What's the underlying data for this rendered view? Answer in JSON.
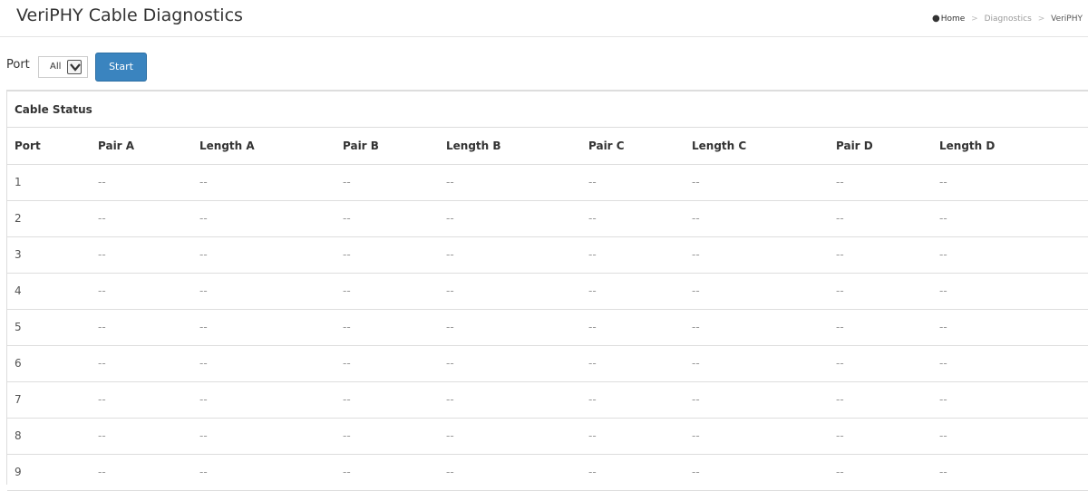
{
  "page": {
    "title": "VeriPHY Cable Diagnostics"
  },
  "breadcrumb": {
    "home": "Home",
    "items": [
      "Diagnostics",
      "VeriPHY"
    ],
    "separator": ">"
  },
  "toolbar": {
    "port_label": "Port",
    "port_value": "All",
    "start_label": "Start"
  },
  "panel": {
    "heading": "Cable Status"
  },
  "table": {
    "columns": [
      "Port",
      "Pair A",
      "Length A",
      "Pair B",
      "Length B",
      "Pair C",
      "Length C",
      "Pair D",
      "Length D"
    ],
    "rows": [
      [
        "1",
        "--",
        "--",
        "--",
        "--",
        "--",
        "--",
        "--",
        "--"
      ],
      [
        "2",
        "--",
        "--",
        "--",
        "--",
        "--",
        "--",
        "--",
        "--"
      ],
      [
        "3",
        "--",
        "--",
        "--",
        "--",
        "--",
        "--",
        "--",
        "--"
      ],
      [
        "4",
        "--",
        "--",
        "--",
        "--",
        "--",
        "--",
        "--",
        "--"
      ],
      [
        "5",
        "--",
        "--",
        "--",
        "--",
        "--",
        "--",
        "--",
        "--"
      ],
      [
        "6",
        "--",
        "--",
        "--",
        "--",
        "--",
        "--",
        "--",
        "--"
      ],
      [
        "7",
        "--",
        "--",
        "--",
        "--",
        "--",
        "--",
        "--",
        "--"
      ],
      [
        "8",
        "--",
        "--",
        "--",
        "--",
        "--",
        "--",
        "--",
        "--"
      ],
      [
        "9",
        "--",
        "--",
        "--",
        "--",
        "--",
        "--",
        "--",
        "--"
      ]
    ]
  },
  "colors": {
    "accent": "#3a84bf",
    "border": "#dddddd"
  }
}
